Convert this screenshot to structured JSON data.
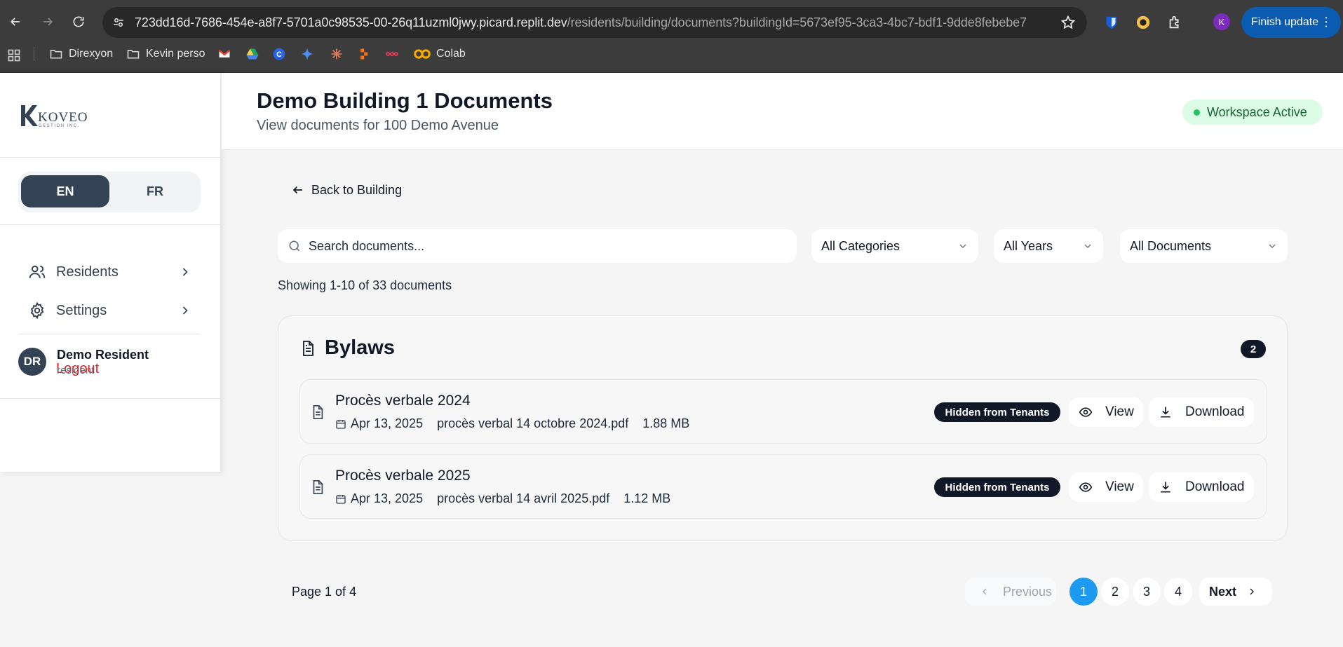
{
  "browser": {
    "url_host": "723dd16d-7686-454e-a8f7-5701a0c98535-00-26q11uzml0jwy.picard.replit.dev",
    "url_path": "/residents/building/documents?buildingId=5673ef95-3ca3-4bc7-bdf1-9dde8febebe7",
    "profile_initial": "K",
    "finish_update_label": "Finish update",
    "bookmarks": [
      "Direxyon",
      "Kevin perso",
      "Colab"
    ]
  },
  "sidebar": {
    "logo_text": "KOVEO",
    "logo_subtext": "GESTION INC.",
    "lang_en": "EN",
    "lang_fr": "FR",
    "nav": [
      {
        "label": "Residents",
        "icon": "users-icon"
      },
      {
        "label": "Settings",
        "icon": "gear-icon"
      }
    ],
    "logout_label": "Logout",
    "user": {
      "initials": "DR",
      "name": "Demo Resident",
      "role": "resident"
    }
  },
  "header": {
    "title": "Demo Building 1 Documents",
    "subtitle": "View documents for 100 Demo Avenue",
    "workspace_status": "Workspace Active"
  },
  "main": {
    "back_label": "Back to Building",
    "search_placeholder": "Search documents...",
    "filters": {
      "category": "All Categories",
      "year": "All Years",
      "documents": "All Documents"
    },
    "showing": "Showing 1-10 of 33 documents",
    "category": {
      "title": "Bylaws",
      "count": "2",
      "documents": [
        {
          "title": "Procès verbale 2024",
          "date": "Apr 13, 2025",
          "file": "procès verbal 14 octobre 2024.pdf",
          "size": "1.88 MB",
          "badge": "Hidden from Tenants",
          "view": "View",
          "download": "Download"
        },
        {
          "title": "Procès verbale 2025",
          "date": "Apr 13, 2025",
          "file": "procès verbal 14 avril 2025.pdf",
          "size": "1.12 MB",
          "badge": "Hidden from Tenants",
          "view": "View",
          "download": "Download"
        }
      ]
    },
    "pagination": {
      "info": "Page 1 of 4",
      "previous": "Previous",
      "pages": [
        "1",
        "2",
        "3",
        "4"
      ],
      "next": "Next",
      "current": "1"
    }
  },
  "colors": {
    "accent": "#1d9bf0",
    "sidebar_active": "#344256",
    "logout": "#dc2626",
    "status_green": "#22c55e"
  }
}
